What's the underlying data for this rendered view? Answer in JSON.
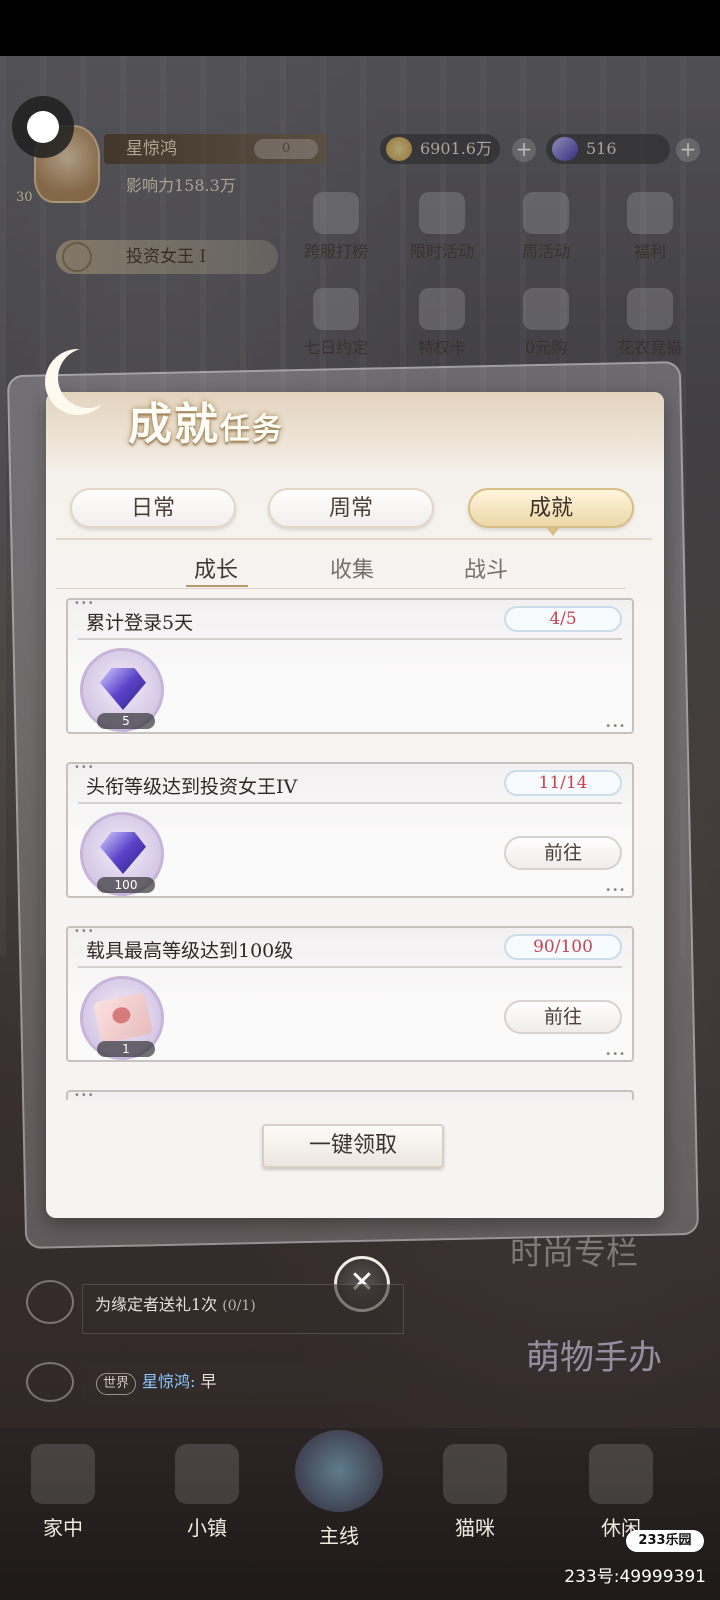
{
  "player": {
    "level": "30",
    "name": "星惊鸿",
    "vip": "0",
    "influence": "影响力158.3万",
    "title": "投资女王 I"
  },
  "currency": {
    "coins": "6901.6万",
    "diamonds": "516",
    "plus": "+"
  },
  "hud_buttons": [
    {
      "label": "跨服打榜",
      "icon": "trophy-icon"
    },
    {
      "label": "限时活动",
      "icon": "event-icon"
    },
    {
      "label": "周活动",
      "icon": "weekly-icon"
    },
    {
      "label": "福利",
      "icon": "gift-icon"
    },
    {
      "label": "七日约定",
      "icon": "calendar-icon"
    },
    {
      "label": "特权卡",
      "icon": "card-icon"
    },
    {
      "label": "0元购",
      "icon": "coin-icon"
    },
    {
      "label": "花农竞猫",
      "icon": "cat-icon"
    }
  ],
  "popup": {
    "title_main": "成就",
    "title_sub": "任务",
    "tabs": [
      "日常",
      "周常",
      "成就"
    ],
    "active_tab": "成就",
    "subtabs": [
      "成长",
      "收集",
      "战斗"
    ],
    "active_subtab": "成长",
    "tasks": [
      {
        "title": "累计登录5天",
        "progress": "4/5",
        "reward": "gem-icon",
        "qty": "5",
        "action": ""
      },
      {
        "title": "头衔等级达到投资女王IV",
        "progress": "11/14",
        "reward": "gem-icon",
        "qty": "100",
        "action": "前往"
      },
      {
        "title": "载具最高等级达到100级",
        "progress": "90/100",
        "reward": "paw-ticket-icon",
        "qty": "1",
        "action": "前往"
      }
    ],
    "claim_all": "一键领取",
    "close": "✕"
  },
  "task_bar": {
    "text": "为缘定者送礼1次",
    "count": "(0/1)"
  },
  "chat": {
    "channel": "世界",
    "speaker": "星惊鸿:",
    "message": " 早"
  },
  "nav": [
    {
      "label": "家中",
      "icon": "house-icon"
    },
    {
      "label": "小镇",
      "icon": "town-icon"
    },
    {
      "label": "主线",
      "icon": "moon-cat-icon"
    },
    {
      "label": "猫咪",
      "icon": "lucky-cat-icon"
    },
    {
      "label": "休闲",
      "icon": "leisure-icon"
    }
  ],
  "brand_logo": "233乐园",
  "watermark": "233号:49999391",
  "colors": {
    "progress_red": "#c94250",
    "tab_gold": "#ecd7a8",
    "chat_speaker": "#8ec7ff"
  }
}
